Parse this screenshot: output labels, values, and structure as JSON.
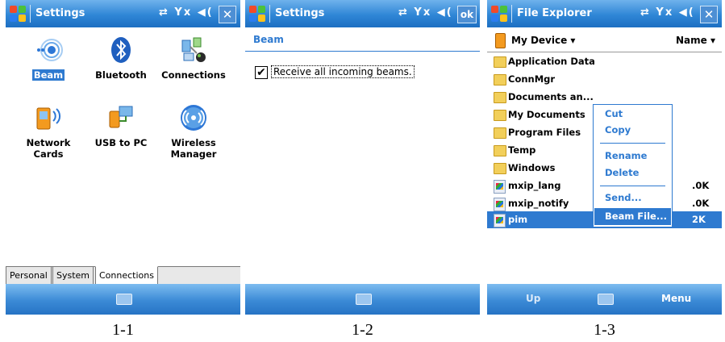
{
  "screens": [
    {
      "title": "Settings",
      "status_icons": "⇄ Yx ◀(",
      "close_label": "✕",
      "items": [
        {
          "label": "Beam",
          "icon": "beam-icon"
        },
        {
          "label": "Bluetooth",
          "icon": "bluetooth-icon"
        },
        {
          "label": "Connections",
          "icon": "connections-icon"
        },
        {
          "label": "Network Cards",
          "icon": "network-cards-icon"
        },
        {
          "label": "USB to PC",
          "icon": "usb-to-pc-icon"
        },
        {
          "label": "Wireless Manager",
          "icon": "wireless-manager-icon"
        }
      ],
      "tabs": [
        "Personal",
        "System",
        "Connections"
      ],
      "active_tab": "Connections",
      "caption": "1-1"
    },
    {
      "title": "Settings",
      "status_icons": "⇄ Yx ◀(",
      "ok_label": "ok",
      "section_header": "Beam",
      "checkbox_label": "Receive all incoming beams.",
      "checkbox_checked": true,
      "caption": "1-2"
    },
    {
      "title": "File Explorer",
      "status_icons": "⇄ Yx ◀(",
      "close_label": "✕",
      "location": "My Device",
      "sort": "Name",
      "files": [
        {
          "name": "Application Data",
          "type": "folder"
        },
        {
          "name": "ConnMgr",
          "type": "folder"
        },
        {
          "name": "Documents an...",
          "type": "folder"
        },
        {
          "name": "My Documents",
          "type": "folder"
        },
        {
          "name": "Program Files",
          "type": "folder"
        },
        {
          "name": "Temp",
          "type": "folder"
        },
        {
          "name": "Windows",
          "type": "folder"
        },
        {
          "name": "mxip_lang",
          "type": "file",
          "size": ".0K"
        },
        {
          "name": "mxip_notify",
          "type": "file",
          "size": ".0K"
        },
        {
          "name": "pim",
          "type": "file",
          "size": "2K",
          "selected": true
        }
      ],
      "context_menu": [
        "Cut",
        "Copy",
        "Rename",
        "Delete",
        "Send...",
        "Beam File..."
      ],
      "softkeys": {
        "left": "Up",
        "right": "Menu"
      },
      "caption": "1-3"
    }
  ],
  "colors": {
    "titlebar": "#2f86d6",
    "selection": "#2e7ad0",
    "header_text": "#2e7ad0"
  }
}
